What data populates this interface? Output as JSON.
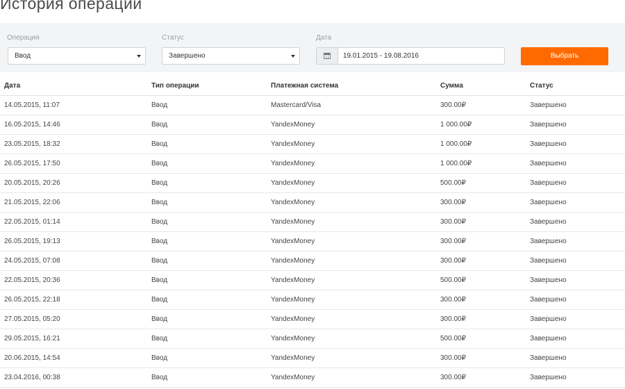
{
  "page_title": "История операции",
  "filters": {
    "operation": {
      "label": "Операция",
      "value": "Ввод"
    },
    "status": {
      "label": "Статус",
      "value": "Завершено"
    },
    "date": {
      "label": "Дата",
      "value": "19.01.2015 - 19.08.2016",
      "icon": "calendar-icon"
    },
    "submit_label": "Выбрать"
  },
  "colors": {
    "accent": "#ff6a00",
    "panel_bg": "#f2f4f6"
  },
  "table": {
    "headers": [
      "Дата",
      "Тип операции",
      "Платежная система",
      "Сумма",
      "Статус"
    ],
    "rows": [
      [
        "14.05.2015, 11:07",
        "Ввод",
        "Mastercard/Visa",
        "300.00₽",
        "Завершено"
      ],
      [
        "16.05.2015, 14:46",
        "Ввод",
        "YandexMoney",
        "1 000.00₽",
        "Завершено"
      ],
      [
        "23.05.2015, 18:32",
        "Ввод",
        "YandexMoney",
        "1 000.00₽",
        "Завершено"
      ],
      [
        "26.05.2015, 17:50",
        "Ввод",
        "YandexMoney",
        "1 000.00₽",
        "Завершено"
      ],
      [
        "20.05.2015, 20:26",
        "Ввод",
        "YandexMoney",
        "500.00₽",
        "Завершено"
      ],
      [
        "21.05.2015, 22:06",
        "Ввод",
        "YandexMoney",
        "300.00₽",
        "Завершено"
      ],
      [
        "22.05.2015, 01:14",
        "Ввод",
        "YandexMoney",
        "300.00₽",
        "Завершено"
      ],
      [
        "26.05.2015, 19:13",
        "Ввод",
        "YandexMoney",
        "300.00₽",
        "Завершено"
      ],
      [
        "24.05.2015, 07:08",
        "Ввод",
        "YandexMoney",
        "300.00₽",
        "Завершено"
      ],
      [
        "22.05.2015, 20:36",
        "Ввод",
        "YandexMoney",
        "500.00₽",
        "Завершено"
      ],
      [
        "26.05.2015, 22:18",
        "Ввод",
        "YandexMoney",
        "300.00₽",
        "Завершено"
      ],
      [
        "27.05.2015, 05:20",
        "Ввод",
        "YandexMoney",
        "300.00₽",
        "Завершено"
      ],
      [
        "29.05.2015, 16:21",
        "Ввод",
        "YandexMoney",
        "500.00₽",
        "Завершено"
      ],
      [
        "20.06.2015, 14:54",
        "Ввод",
        "YandexMoney",
        "300.00₽",
        "Завершено"
      ],
      [
        "23.04.2016, 00:38",
        "Ввод",
        "YandexMoney",
        "300.00₽",
        "Завершено"
      ]
    ]
  }
}
